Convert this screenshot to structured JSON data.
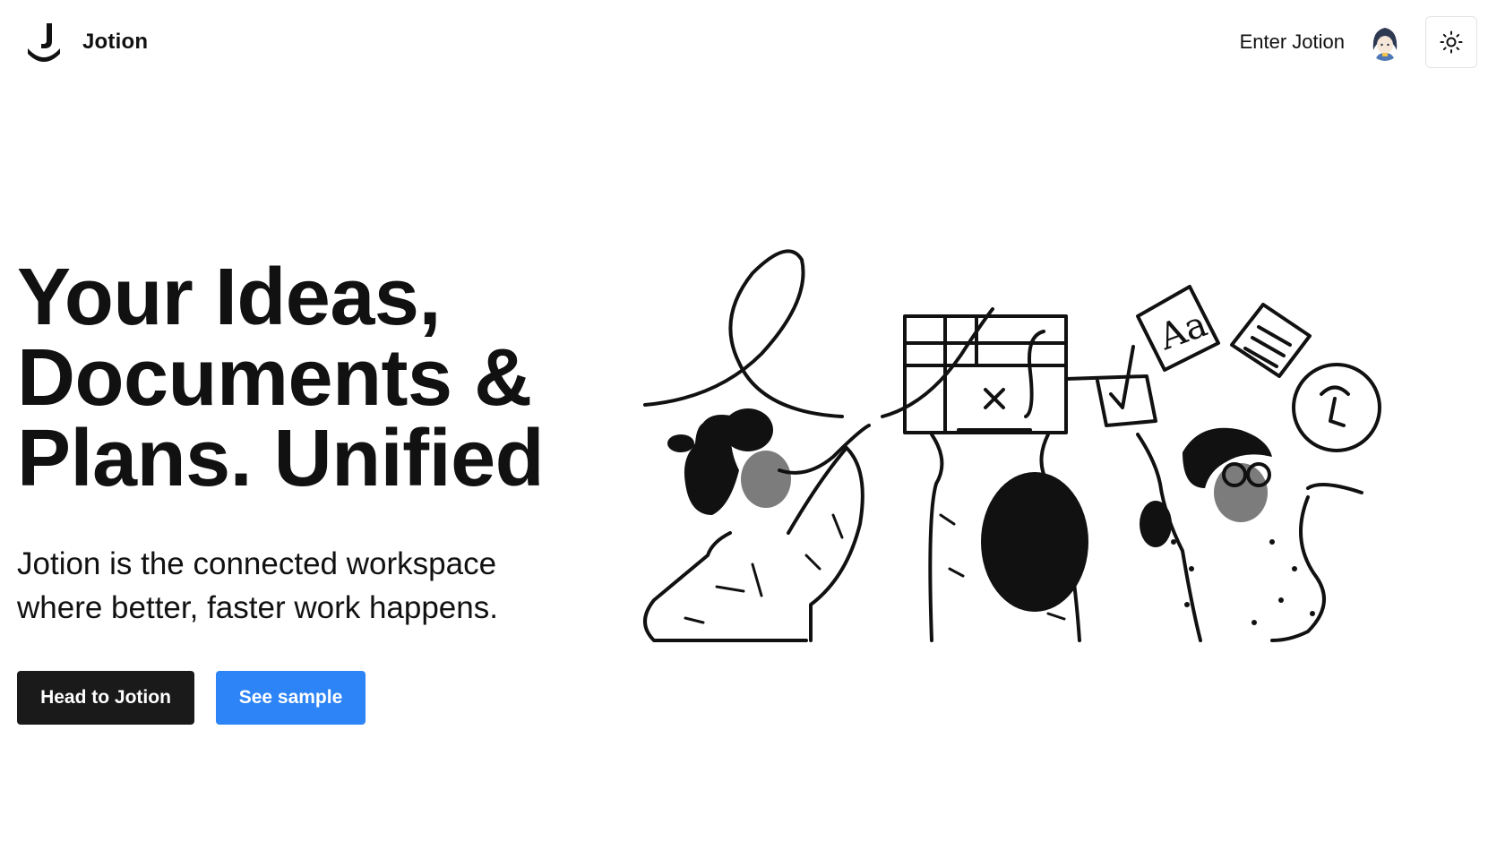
{
  "app": {
    "brand_name": "Jotion",
    "logo_icon": "jotion-logo-icon"
  },
  "nav": {
    "enter_label": "Enter Jotion",
    "avatar_icon": "user-avatar",
    "theme_toggle_icon": "sun-icon"
  },
  "hero": {
    "headline_lines": [
      "Your Ideas,",
      "Documents &",
      "Plans. Unified"
    ],
    "subtext_lines": [
      "Jotion is the connected workspace",
      "where better, faster work happens."
    ],
    "primary_cta": "Head to Jotion",
    "secondary_cta": "See sample",
    "illustration_icon": "people-collaborating-illustration"
  },
  "colors": {
    "primary_button": "#1a1a1a",
    "accent_button": "#2d84f6",
    "background": "#ffffff",
    "text": "#111111"
  }
}
